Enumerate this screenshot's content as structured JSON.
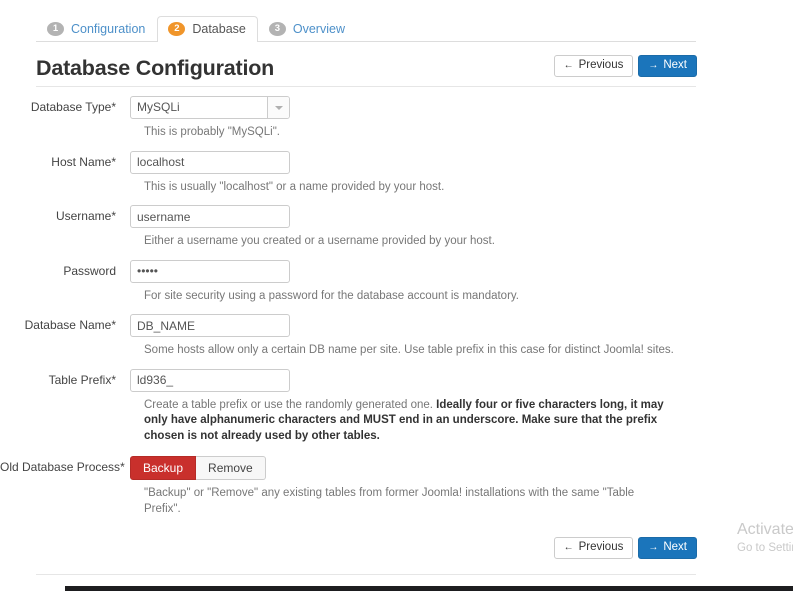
{
  "steps": [
    {
      "num": "1",
      "label": "Configuration",
      "active": false
    },
    {
      "num": "2",
      "label": "Database",
      "active": true
    },
    {
      "num": "3",
      "label": "Overview",
      "active": false
    }
  ],
  "header": {
    "title": "Database Configuration",
    "previous_label": "Previous",
    "next_label": "Next",
    "previous_arrow": "←",
    "next_arrow": "→"
  },
  "form": {
    "database_type": {
      "label": "Database Type",
      "required": "*",
      "value": "MySQLi",
      "help": "This is probably \"MySQLi\"."
    },
    "host_name": {
      "label": "Host Name",
      "required": "*",
      "value": "localhost",
      "help": "This is usually \"localhost\" or a name provided by your host."
    },
    "username": {
      "label": "Username",
      "required": "*",
      "value": "username",
      "help": "Either a username you created or a username provided by your host."
    },
    "password": {
      "label": "Password",
      "required": "",
      "value": "•••••",
      "help": "For site security using a password for the database account is mandatory."
    },
    "database_name": {
      "label": "Database Name",
      "required": "*",
      "value": "DB_NAME",
      "help": "Some hosts allow only a certain DB name per site. Use table prefix in this case for distinct Joomla! sites."
    },
    "table_prefix": {
      "label": "Table Prefix",
      "required": "*",
      "value": "ld936_",
      "help_plain_1": "Create a table prefix or use the randomly generated one. ",
      "help_bold": "Ideally four or five characters long, it may only have alphanumeric characters and MUST end in an underscore. Make sure that the prefix chosen is not already used by other tables.",
      "help_plain_2": ""
    },
    "old_database_process": {
      "label": "Old Database Process",
      "required": "*",
      "options": [
        "Backup",
        "Remove"
      ],
      "selected": "Backup",
      "help": "\"Backup\" or \"Remove\" any existing tables from former Joomla! installations with the same \"Table Prefix\"."
    }
  },
  "watermark": {
    "line1": "Activate Windows",
    "line2": "Go to Settings to activate Windows."
  },
  "colors": {
    "primary": "#1b75bb",
    "danger": "#c9302c",
    "accent_orange": "#f0952a",
    "link": "#4d90c9"
  }
}
